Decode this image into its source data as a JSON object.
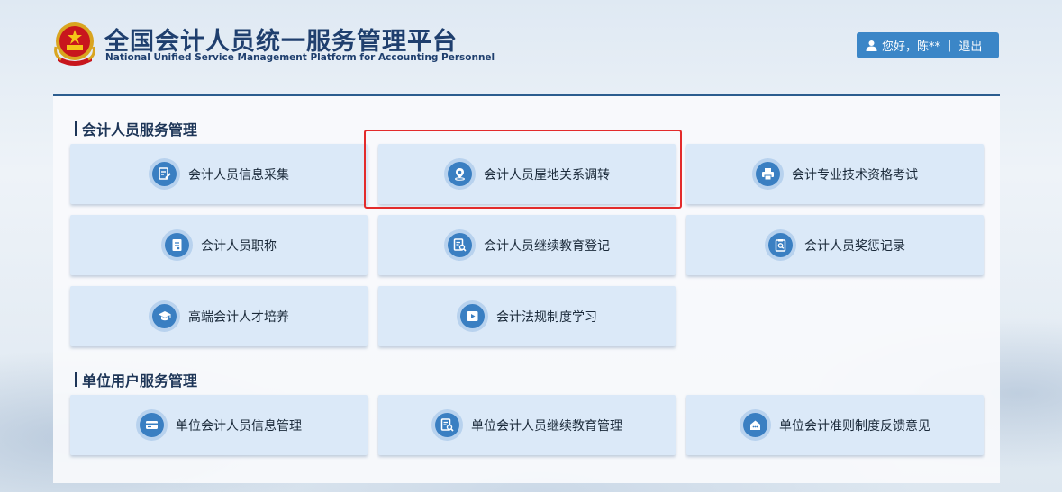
{
  "header": {
    "title_cn": "全国会计人员统一服务管理平台",
    "title_en": "National Unified Service Management Platform for Accounting Personnel",
    "emblem_icon": "national-emblem-icon"
  },
  "user": {
    "greeting": "您好，陈**",
    "separator": "|",
    "logout_label": "退出",
    "icon": "user-icon"
  },
  "sections": [
    {
      "title": "会计人员服务管理",
      "cards": [
        {
          "label": "会计人员信息采集",
          "icon": "edit-document-icon"
        },
        {
          "label": "会计人员屋地关系调转",
          "icon": "location-pin-icon",
          "highlighted": true
        },
        {
          "label": "会计专业技术资格考试",
          "icon": "printer-icon"
        },
        {
          "label": "会计人员职称",
          "icon": "certificate-icon"
        },
        {
          "label": "会计人员继续教育登记",
          "icon": "document-search-icon"
        },
        {
          "label": "会计人员奖惩记录",
          "icon": "clipboard-search-icon"
        },
        {
          "label": "高端会计人才培养",
          "icon": "graduation-cap-icon"
        },
        {
          "label": "会计法规制度学习",
          "icon": "video-play-icon"
        }
      ]
    },
    {
      "title": "单位用户服务管理",
      "cards": [
        {
          "label": "单位会计人员信息管理",
          "icon": "card-icon"
        },
        {
          "label": "单位会计人员继续教育管理",
          "icon": "document-search-icon"
        },
        {
          "label": "单位会计准则制度反馈意见",
          "icon": "feedback-icon"
        }
      ]
    }
  ],
  "colors": {
    "accent": "#3b86c7",
    "title": "#1f3f6e",
    "card_bg": "#dbe9f8",
    "highlight": "#e32b2b"
  }
}
